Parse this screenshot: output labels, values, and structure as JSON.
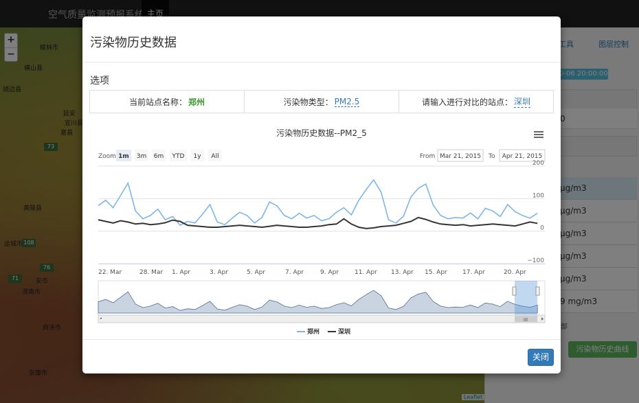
{
  "app": {
    "title": "空气质量监测预报系统",
    "nav_home": "主页"
  },
  "map": {
    "zoom_in": "+",
    "zoom_out": "−",
    "cities": [
      "榆林市",
      "横山县",
      "靖边县",
      "延安",
      "富县",
      "宜川县",
      "黄陵县",
      "运城市",
      "安市",
      "渭南市",
      "商洛市",
      "安康市"
    ],
    "roads": [
      "73",
      "108",
      "76",
      "71"
    ],
    "attribution": "Leaflet"
  },
  "right_panel": {
    "tools": "工具",
    "layer_control": "图层控制",
    "time_badge": "0-06 20:00:00",
    "value_row_top": "0",
    "values": [
      "μg/m3",
      "μg/m3",
      "μg/m3",
      "μg/m3",
      "μg/m3",
      "9  mg/m3"
    ],
    "note": "部",
    "history_button": "污染物历史曲线"
  },
  "modal": {
    "title": "污染物历史数据",
    "section": "选项",
    "options": {
      "station_label": "当前站点名称：",
      "station_value": "郑州",
      "pollutant_label": "污染物类型：",
      "pollutant_value": "PM2.5",
      "compare_label": "请输入进行对比的站点：",
      "compare_value": "深圳"
    },
    "close_button": "关闭"
  },
  "chart_data": {
    "type": "line",
    "title": "污染物历史数据--PM2_5",
    "menu_icon": "hamburger-menu-icon",
    "range_selector": {
      "zoom_label": "Zoom",
      "buttons": [
        "1m",
        "3m",
        "6m",
        "YTD",
        "1y",
        "All"
      ],
      "selected": "1m",
      "from_label": "From",
      "from": "Mar 21, 2015",
      "to_label": "To",
      "to": "Apr 21, 2015"
    },
    "x_tick_labels": [
      "22. Mar",
      "28. Mar",
      "1. Apr",
      "3. Apr",
      "5. Apr",
      "7. Apr",
      "9. Apr",
      "11. Apr",
      "13. Apr",
      "15. Apr",
      "17. Apr",
      "20. Apr"
    ],
    "y_tick_labels": [
      "200",
      "100",
      "0",
      "−100"
    ],
    "ylim": [
      -100,
      200
    ],
    "xlim": [
      0,
      30
    ],
    "grid": true,
    "legend_position": "bottom",
    "navigator_handle_label": "III",
    "series": [
      {
        "name": "郑州",
        "color": "#7cb5ec",
        "points": [
          [
            0,
            78
          ],
          [
            0.5,
            95
          ],
          [
            1,
            72
          ],
          [
            1.5,
            110
          ],
          [
            2,
            148
          ],
          [
            2.5,
            62
          ],
          [
            3,
            38
          ],
          [
            3.5,
            48
          ],
          [
            4,
            68
          ],
          [
            4.5,
            35
          ],
          [
            5,
            45
          ],
          [
            5.5,
            18
          ],
          [
            6,
            30
          ],
          [
            6.5,
            25
          ],
          [
            7,
            52
          ],
          [
            7.5,
            82
          ],
          [
            8,
            28
          ],
          [
            8.5,
            20
          ],
          [
            9,
            40
          ],
          [
            9.5,
            58
          ],
          [
            10,
            48
          ],
          [
            10.5,
            25
          ],
          [
            11,
            42
          ],
          [
            11.5,
            90
          ],
          [
            12,
            78
          ],
          [
            12.5,
            48
          ],
          [
            13,
            38
          ],
          [
            13.5,
            55
          ],
          [
            14,
            40
          ],
          [
            14.5,
            48
          ],
          [
            15,
            32
          ],
          [
            15.5,
            38
          ],
          [
            16,
            58
          ],
          [
            16.5,
            72
          ],
          [
            17,
            50
          ],
          [
            17.5,
            95
          ],
          [
            18,
            128
          ],
          [
            18.5,
            158
          ],
          [
            19,
            120
          ],
          [
            19.5,
            35
          ],
          [
            20,
            25
          ],
          [
            20.5,
            46
          ],
          [
            21,
            105
          ],
          [
            21.5,
            132
          ],
          [
            22,
            145
          ],
          [
            22.5,
            80
          ],
          [
            23,
            48
          ],
          [
            23.5,
            38
          ],
          [
            24,
            42
          ],
          [
            24.5,
            40
          ],
          [
            25,
            56
          ],
          [
            25.5,
            38
          ],
          [
            26,
            70
          ],
          [
            26.5,
            62
          ],
          [
            27,
            45
          ],
          [
            27.5,
            82
          ],
          [
            28,
            60
          ],
          [
            28.5,
            48
          ],
          [
            29,
            40
          ],
          [
            29.5,
            55
          ]
        ]
      },
      {
        "name": "深圳",
        "color": "#333333",
        "points": [
          [
            0,
            35
          ],
          [
            0.5,
            30
          ],
          [
            1,
            25
          ],
          [
            1.5,
            32
          ],
          [
            2,
            28
          ],
          [
            2.5,
            22
          ],
          [
            3,
            24
          ],
          [
            3.5,
            20
          ],
          [
            4,
            22
          ],
          [
            4.5,
            26
          ],
          [
            5,
            34
          ],
          [
            5.5,
            30
          ],
          [
            6,
            18
          ],
          [
            6.5,
            16
          ],
          [
            7,
            14
          ],
          [
            7.5,
            12
          ],
          [
            8,
            12
          ],
          [
            8.5,
            14
          ],
          [
            9,
            16
          ],
          [
            9.5,
            18
          ],
          [
            10,
            16
          ],
          [
            10.5,
            14
          ],
          [
            11,
            12
          ],
          [
            11.5,
            15
          ],
          [
            12,
            18
          ],
          [
            12.5,
            16
          ],
          [
            13,
            14
          ],
          [
            13.5,
            12
          ],
          [
            14,
            12
          ],
          [
            14.5,
            14
          ],
          [
            15,
            16
          ],
          [
            15.5,
            20
          ],
          [
            16,
            22
          ],
          [
            16.5,
            38
          ],
          [
            17,
            22
          ],
          [
            17.5,
            12
          ],
          [
            18,
            8
          ],
          [
            18.5,
            10
          ],
          [
            19,
            14
          ],
          [
            19.5,
            16
          ],
          [
            20,
            18
          ],
          [
            20.5,
            24
          ],
          [
            21,
            30
          ],
          [
            21.5,
            42
          ],
          [
            22,
            36
          ],
          [
            22.5,
            28
          ],
          [
            23,
            22
          ],
          [
            23.5,
            20
          ],
          [
            24,
            18
          ],
          [
            24.5,
            20
          ],
          [
            25,
            16
          ],
          [
            25.5,
            18
          ],
          [
            26,
            20
          ],
          [
            26.5,
            22
          ],
          [
            27,
            20
          ],
          [
            27.5,
            18
          ],
          [
            28,
            16
          ],
          [
            28.5,
            22
          ],
          [
            29,
            28
          ],
          [
            29.5,
            24
          ]
        ]
      }
    ]
  }
}
